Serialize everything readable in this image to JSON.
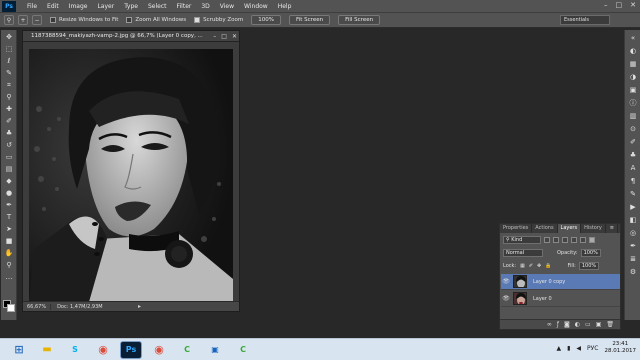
{
  "app": {
    "logo": "Ps"
  },
  "menu": [
    "File",
    "Edit",
    "Image",
    "Layer",
    "Type",
    "Select",
    "Filter",
    "3D",
    "View",
    "Window",
    "Help"
  ],
  "options": {
    "resize_windows": "Resize Windows to Fit",
    "zoom_all": "Zoom All Windows",
    "scrubby_zoom": "Scrubby Zoom",
    "zoom_value": "100%",
    "fit_screen": "Fit Screen",
    "fill_screen": "Fill Screen",
    "workspace": "Essentials"
  },
  "document": {
    "title": "1187388594_makiyazh-vamp-2.jpg @ 66,7% (Layer 0 copy, ...",
    "zoom": "66,67%",
    "info": "Doc: 1,47M/2,93M"
  },
  "layers_panel": {
    "tabs": [
      "Properties",
      "Actions",
      "Layers",
      "History"
    ],
    "active_tab": "Layers",
    "kind": "Kind",
    "blend_mode": "Normal",
    "opacity_label": "Opacity:",
    "opacity_value": "100%",
    "lock_label": "Lock:",
    "fill_label": "Fill:",
    "fill_value": "100%",
    "layers": [
      {
        "name": "Layer 0 copy",
        "selected": true
      },
      {
        "name": "Layer 0",
        "selected": false
      }
    ]
  },
  "taskbar": {
    "lang": "РУС",
    "time": "23:41",
    "date": "28.01.2017"
  },
  "colors": {
    "accent": "#5a7ab6",
    "chrome": "#535353",
    "workspace_bg": "#282828"
  }
}
